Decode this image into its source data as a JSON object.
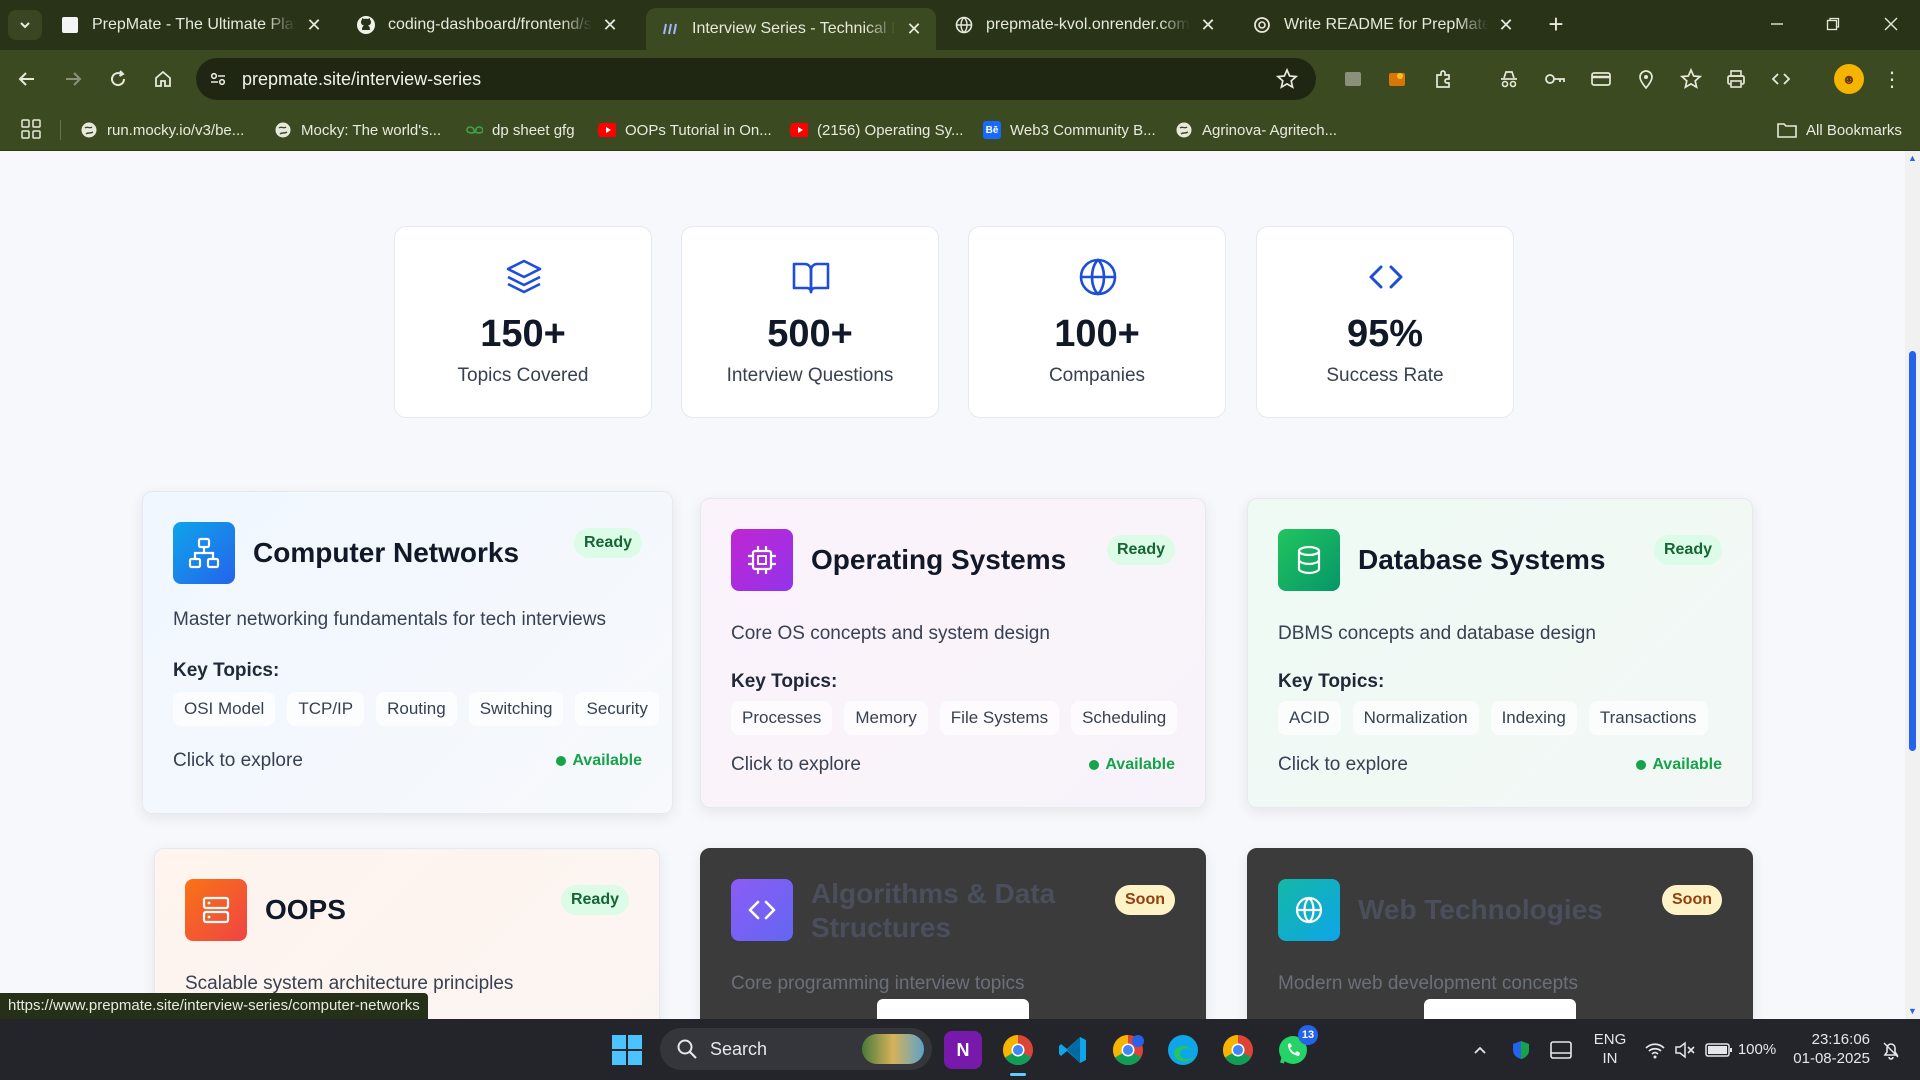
{
  "browser": {
    "tabs": [
      {
        "title": "PrepMate - The Ultimate Platform for Placement Prep",
        "icon": "page-icon",
        "active": false
      },
      {
        "title": "coding-dashboard/frontend/src",
        "icon": "github-icon",
        "active": false
      },
      {
        "title": "Interview Series - Technical Interview Prep",
        "icon": "prepmate-icon",
        "active": true
      },
      {
        "title": "prepmate-kvol.onrender.com/api",
        "icon": "globe-icon",
        "active": false
      },
      {
        "title": "Write README for PrepMate",
        "icon": "openai-icon",
        "active": false
      }
    ],
    "url": "prepmate.site/interview-series",
    "bookmarks": [
      {
        "label": "run.mocky.io/v3/be...",
        "icon": "globe-icon"
      },
      {
        "label": "Mocky: The world's...",
        "icon": "globe-icon"
      },
      {
        "label": "dp sheet gfg",
        "icon": "gfg-icon"
      },
      {
        "label": "OOPs Tutorial in On...",
        "icon": "youtube-icon"
      },
      {
        "label": "(2156) Operating Sy...",
        "icon": "youtube-icon"
      },
      {
        "label": "Web3 Community B...",
        "icon": "behance-icon"
      },
      {
        "label": "Agrinova- Agritech...",
        "icon": "globe-icon"
      }
    ],
    "all_bookmarks": "All Bookmarks",
    "status_url": "https://www.prepmate.site/interview-series/computer-networks"
  },
  "stats": [
    {
      "value": "150+",
      "label": "Topics Covered",
      "icon": "layers-icon"
    },
    {
      "value": "500+",
      "label": "Interview Questions",
      "icon": "book-open-icon"
    },
    {
      "value": "100+",
      "label": "Companies",
      "icon": "globe-icon"
    },
    {
      "value": "95%",
      "label": "Success Rate",
      "icon": "code-icon"
    }
  ],
  "cards": [
    {
      "title": "Computer Networks",
      "badge": "Ready",
      "desc": "Master networking fundamentals for tech interviews",
      "key_topics_label": "Key Topics:",
      "topics": [
        "OSI Model",
        "TCP/IP",
        "Routing",
        "Switching",
        "Security"
      ],
      "explore": "Click to explore",
      "status": "Available",
      "icon": "network-icon",
      "accent": "#1d8fe8"
    },
    {
      "title": "Operating Systems",
      "badge": "Ready",
      "desc": "Core OS concepts and system design",
      "key_topics_label": "Key Topics:",
      "topics": [
        "Processes",
        "Memory",
        "File Systems",
        "Scheduling"
      ],
      "explore": "Click to explore",
      "status": "Available",
      "icon": "cpu-icon",
      "accent": "#c026d3"
    },
    {
      "title": "Database Systems",
      "badge": "Ready",
      "desc": "DBMS concepts and database design",
      "key_topics_label": "Key Topics:",
      "topics": [
        "ACID",
        "Normalization",
        "Indexing",
        "Transactions"
      ],
      "explore": "Click to explore",
      "status": "Available",
      "icon": "database-icon",
      "accent": "#16a34a"
    },
    {
      "title": "OOPS",
      "badge": "Ready",
      "desc": "Scalable system architecture principles",
      "icon": "server-icon",
      "accent": "#f97316"
    },
    {
      "title": "Algorithms & Data Structures",
      "badge": "Soon",
      "desc": "Core programming interview topics",
      "icon": "code-icon",
      "accent": "#8b5cf6"
    },
    {
      "title": "Web Technologies",
      "badge": "Soon",
      "desc": "Modern web development concepts",
      "icon": "globe-icon",
      "accent": "#14b8a6"
    }
  ],
  "taskbar": {
    "search_label": "Search",
    "whatsapp_badge": "13",
    "lang": "ENG",
    "region": "IN",
    "battery": "100%",
    "time": "23:16:06",
    "date": "01-08-2025"
  }
}
